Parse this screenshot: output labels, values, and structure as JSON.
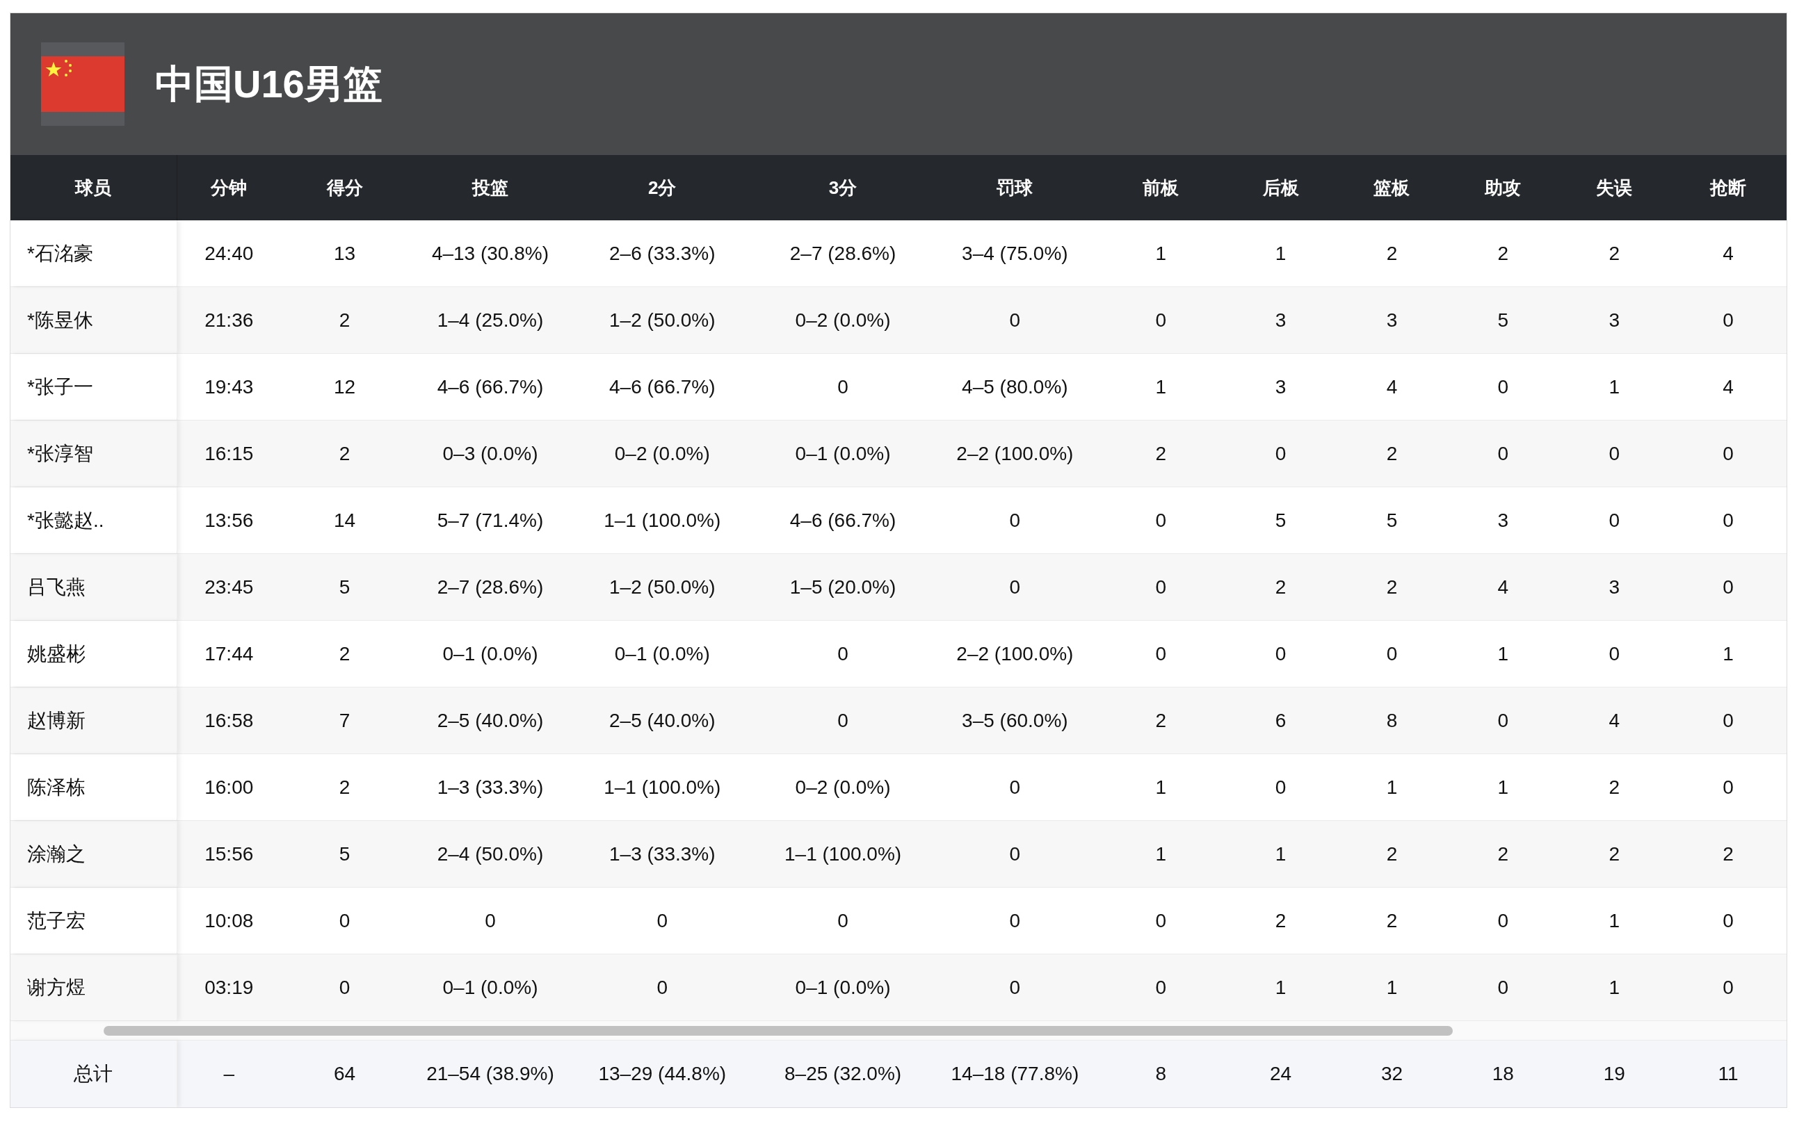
{
  "team": {
    "name": "中国U16男篮"
  },
  "table": {
    "columns": [
      "球员",
      "分钟",
      "得分",
      "投篮",
      "2分",
      "3分",
      "罚球",
      "前板",
      "后板",
      "篮板",
      "助攻",
      "失误",
      "抢断"
    ],
    "rows": [
      [
        "*石洺豪",
        "24:40",
        "13",
        "4–13 (30.8%)",
        "2–6 (33.3%)",
        "2–7 (28.6%)",
        "3–4 (75.0%)",
        "1",
        "1",
        "2",
        "2",
        "2",
        "4"
      ],
      [
        "*陈昱休",
        "21:36",
        "2",
        "1–4 (25.0%)",
        "1–2 (50.0%)",
        "0–2 (0.0%)",
        "0",
        "0",
        "3",
        "3",
        "5",
        "3",
        "0"
      ],
      [
        "*张子一",
        "19:43",
        "12",
        "4–6 (66.7%)",
        "4–6 (66.7%)",
        "0",
        "4–5 (80.0%)",
        "1",
        "3",
        "4",
        "0",
        "1",
        "4"
      ],
      [
        "*张淳智",
        "16:15",
        "2",
        "0–3 (0.0%)",
        "0–2 (0.0%)",
        "0–1 (0.0%)",
        "2–2 (100.0%)",
        "2",
        "0",
        "2",
        "0",
        "0",
        "0"
      ],
      [
        "*张懿赵..",
        "13:56",
        "14",
        "5–7 (71.4%)",
        "1–1 (100.0%)",
        "4–6 (66.7%)",
        "0",
        "0",
        "5",
        "5",
        "3",
        "0",
        "0"
      ],
      [
        "吕飞燕",
        "23:45",
        "5",
        "2–7 (28.6%)",
        "1–2 (50.0%)",
        "1–5 (20.0%)",
        "0",
        "0",
        "2",
        "2",
        "4",
        "3",
        "0"
      ],
      [
        "姚盛彬",
        "17:44",
        "2",
        "0–1 (0.0%)",
        "0–1 (0.0%)",
        "0",
        "2–2 (100.0%)",
        "0",
        "0",
        "0",
        "1",
        "0",
        "1"
      ],
      [
        "赵博新",
        "16:58",
        "7",
        "2–5 (40.0%)",
        "2–5 (40.0%)",
        "0",
        "3–5 (60.0%)",
        "2",
        "6",
        "8",
        "0",
        "4",
        "0"
      ],
      [
        "陈泽栋",
        "16:00",
        "2",
        "1–3 (33.3%)",
        "1–1 (100.0%)",
        "0–2 (0.0%)",
        "0",
        "1",
        "0",
        "1",
        "1",
        "2",
        "0"
      ],
      [
        "涂瀚之",
        "15:56",
        "5",
        "2–4 (50.0%)",
        "1–3 (33.3%)",
        "1–1 (100.0%)",
        "0",
        "1",
        "1",
        "2",
        "2",
        "2",
        "2"
      ],
      [
        "范子宏",
        "10:08",
        "0",
        "0",
        "0",
        "0",
        "0",
        "0",
        "2",
        "2",
        "0",
        "1",
        "0"
      ],
      [
        "谢方煜",
        "03:19",
        "0",
        "0–1 (0.0%)",
        "0",
        "0–1 (0.0%)",
        "0",
        "0",
        "1",
        "1",
        "0",
        "1",
        "0"
      ]
    ],
    "totals": [
      "总计",
      "–",
      "64",
      "21–54 (38.9%)",
      "13–29 (44.8%)",
      "8–25 (32.0%)",
      "14–18 (77.8%)",
      "8",
      "24",
      "32",
      "18",
      "19",
      "11"
    ]
  }
}
